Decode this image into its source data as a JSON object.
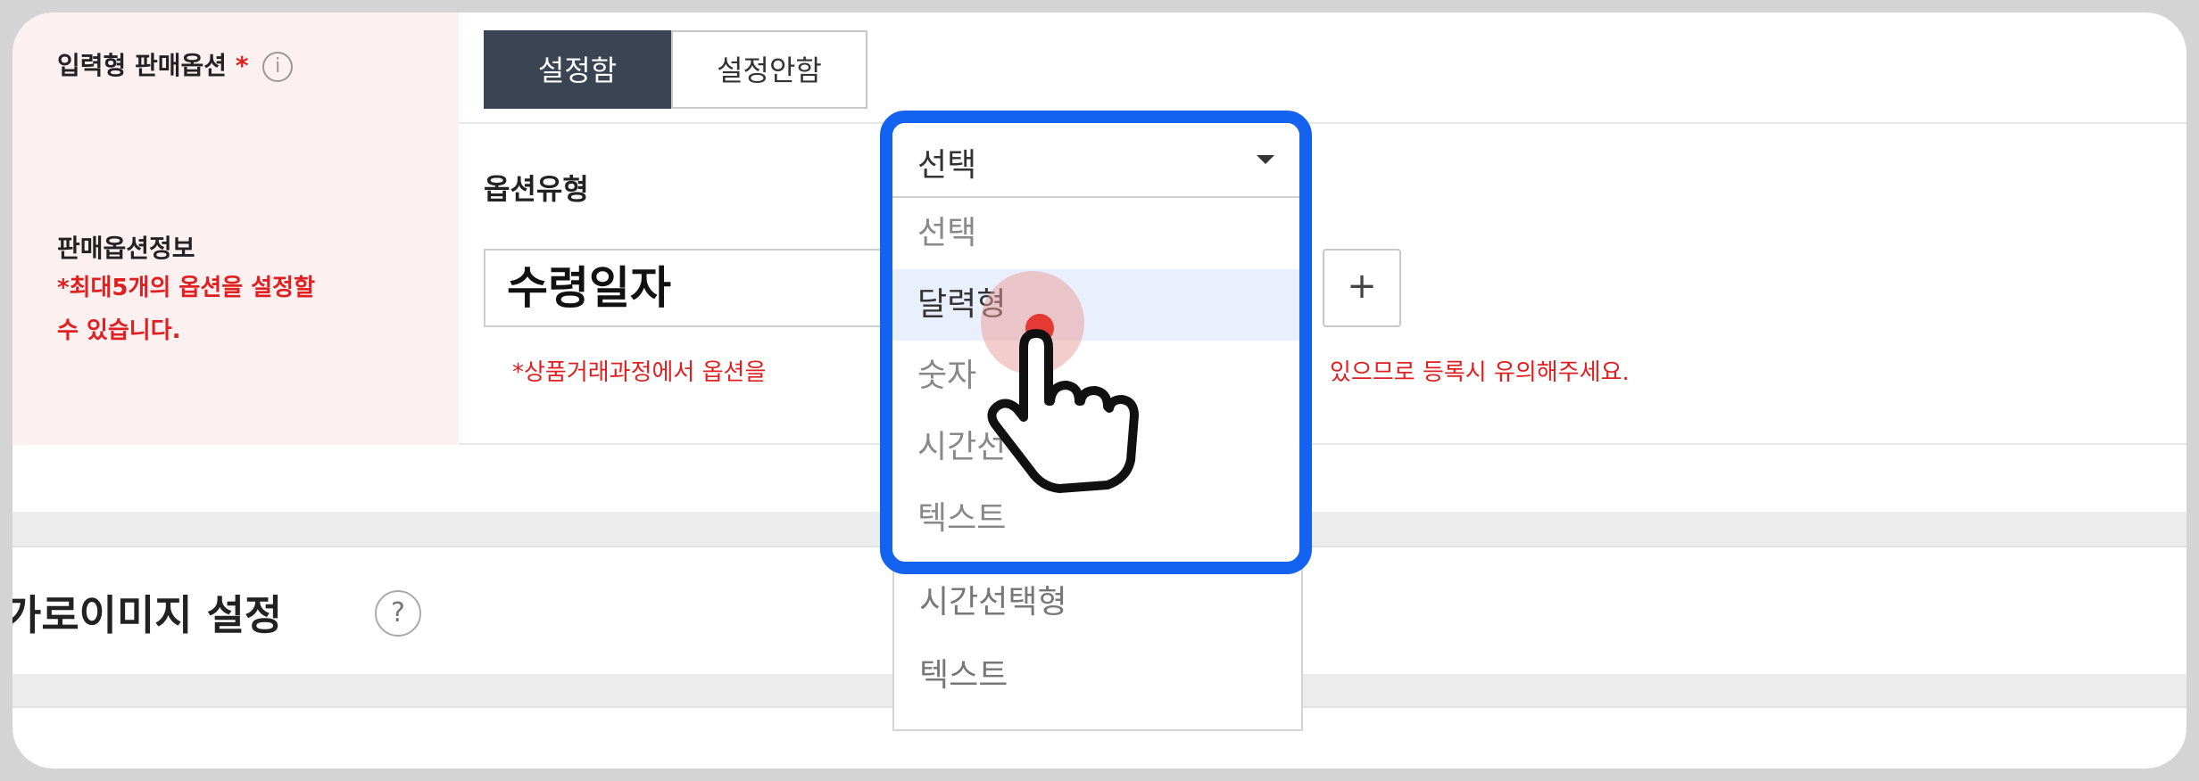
{
  "input_option": {
    "label": "입력형 판매옵션",
    "star": "*",
    "info": "i",
    "on_label": "설정함",
    "off_label": "설정안함"
  },
  "sale_option_info": {
    "label": "판매옵션정보",
    "note_line1": "*최대5개의 옵션을 설정할",
    "note_line2": "수 있습니다.",
    "option_type_label": "옵션유형",
    "option_name_value": "수령일자",
    "plus": "+",
    "warning_left": "*상품거래과정에서 옵션을",
    "warning_right": "있으므로 등록시 유의해주세요."
  },
  "image_section": {
    "title": "가로이미지 설정",
    "help": "?"
  },
  "dropdown": {
    "selected": "선택",
    "options": [
      "선택",
      "달력형",
      "숫자",
      "시간선택형",
      "텍스트"
    ],
    "highlighted_index": 1
  },
  "bg_dropdown_visible": [
    "시간선택형",
    "텍스트"
  ],
  "colors": {
    "accent": "#1463f0",
    "required": "#e02020",
    "segment_on": "#3b4452",
    "label_bg": "#fcf0f0"
  }
}
